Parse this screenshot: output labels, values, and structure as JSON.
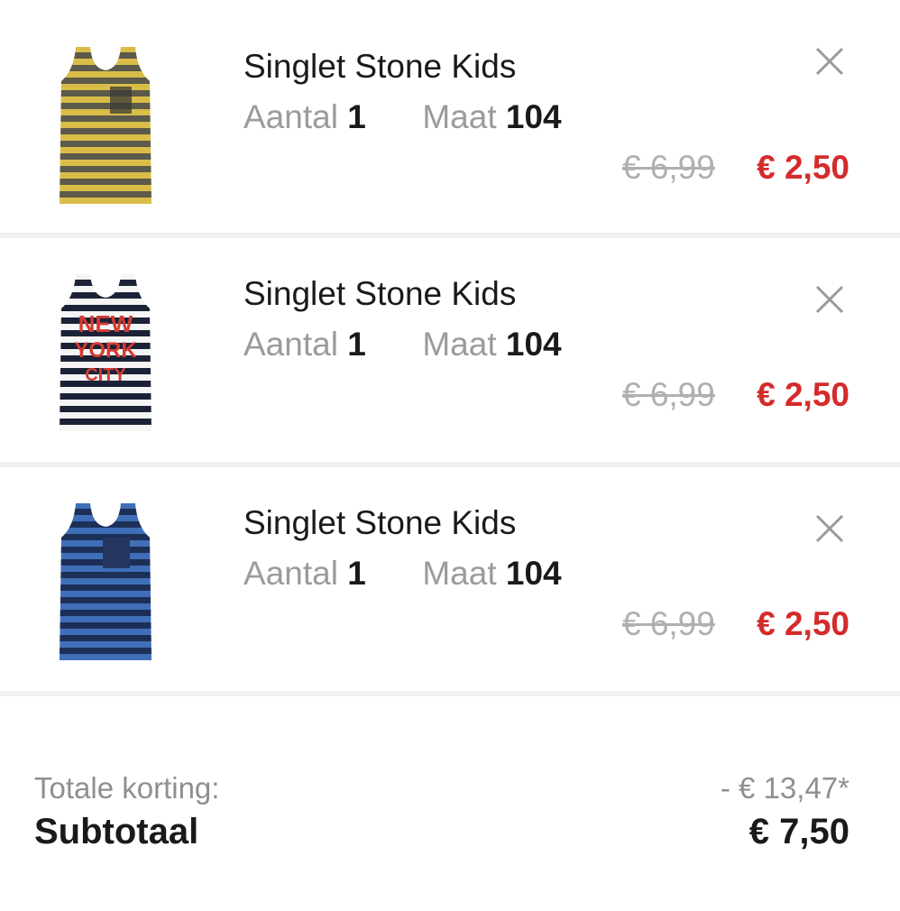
{
  "colors": {
    "sale_price": "#d42b2b",
    "old_price": "#b0b0b0",
    "muted_label": "#9b9b9b",
    "divider": "#f1f1f1"
  },
  "cart": {
    "items": [
      {
        "title": "Singlet Stone Kids",
        "quantity_label": "Aantal",
        "quantity": "1",
        "size_label": "Maat",
        "size": "104",
        "old_price": "€ 6,99",
        "price": "€ 2,50",
        "image": "yellow-grey-striped-singlet",
        "remove_icon": "close-icon"
      },
      {
        "title": "Singlet Stone Kids",
        "quantity_label": "Aantal",
        "quantity": "1",
        "size_label": "Maat",
        "size": "104",
        "old_price": "€ 6,99",
        "price": "€ 2,50",
        "image": "navy-white-striped-singlet-new-york-city",
        "image_text": [
          "NEW",
          "YORK",
          "CITY"
        ],
        "remove_icon": "close-icon"
      },
      {
        "title": "Singlet Stone Kids",
        "quantity_label": "Aantal",
        "quantity": "1",
        "size_label": "Maat",
        "size": "104",
        "old_price": "€ 6,99",
        "price": "€ 2,50",
        "image": "blue-navy-striped-singlet-pocket",
        "remove_icon": "close-icon"
      }
    ]
  },
  "summary": {
    "discount_label": "Totale korting:",
    "discount_value": "- € 13,47*",
    "subtotal_label": "Subtotaal",
    "subtotal_value": "€ 7,50"
  }
}
